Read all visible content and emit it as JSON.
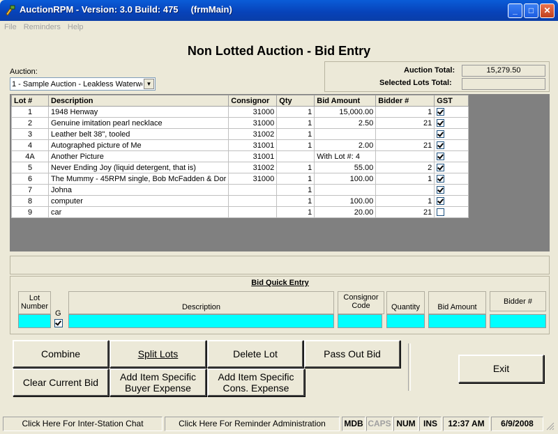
{
  "window": {
    "title": "AuctionRPM - Version: 3.0 Build: 475     (frmMain)"
  },
  "menu": [
    "File",
    "Reminders",
    "Help"
  ],
  "heading": "Non Lotted Auction - Bid Entry",
  "auction": {
    "label": "Auction:",
    "selected": "1 - Sample Auction - Leakless Waterwo"
  },
  "totals": {
    "auction_label": "Auction Total:",
    "auction_value": "15,279.50",
    "selected_label": "Selected Lots Total:",
    "selected_value": ""
  },
  "grid": {
    "headers": [
      "Lot #",
      "Description",
      "Consignor",
      "Qty",
      "Bid Amount",
      "Bidder #",
      "GST"
    ],
    "rows": [
      {
        "lot": "1",
        "desc": "1948 Henway",
        "consignor": "31000",
        "qty": "1",
        "bid": "15,000.00",
        "bidder": "1",
        "gst": true
      },
      {
        "lot": "2",
        "desc": "Genuine imitation pearl necklace",
        "consignor": "31000",
        "qty": "1",
        "bid": "2.50",
        "bidder": "21",
        "gst": true
      },
      {
        "lot": "3",
        "desc": "Leather belt 38\", tooled",
        "consignor": "31002",
        "qty": "1",
        "bid": "",
        "bidder": "",
        "gst": true
      },
      {
        "lot": "4",
        "desc": "Autographed picture of Me",
        "consignor": "31001",
        "qty": "1",
        "bid": "2.00",
        "bidder": "21",
        "gst": true
      },
      {
        "lot": "4A",
        "desc": "Another Picture",
        "consignor": "31001",
        "qty": "",
        "bid": "With Lot #: 4",
        "bidder": "",
        "gst": true
      },
      {
        "lot": "5",
        "desc": "Never Ending Joy (liquid detergent, that is)",
        "consignor": "31002",
        "qty": "1",
        "bid": "55.00",
        "bidder": "2",
        "gst": true
      },
      {
        "lot": "6",
        "desc": "The Mummy - 45RPM single, Bob McFadden & Dor",
        "consignor": "31000",
        "qty": "1",
        "bid": "100.00",
        "bidder": "1",
        "gst": true
      },
      {
        "lot": "7",
        "desc": "Johna",
        "consignor": "",
        "qty": "1",
        "bid": "",
        "bidder": "",
        "gst": true
      },
      {
        "lot": "8",
        "desc": "computer",
        "consignor": "",
        "qty": "1",
        "bid": "100.00",
        "bidder": "1",
        "gst": true
      },
      {
        "lot": "9",
        "desc": "car",
        "consignor": "",
        "qty": "1",
        "bid": "20.00",
        "bidder": "21",
        "gst": false
      }
    ]
  },
  "quick_entry": {
    "title": "Bid Quick Entry",
    "lot_label": "Lot Number",
    "g_label": "G",
    "description_label": "Description",
    "consignor_label": "Consignor Code",
    "quantity_label": "Quantity",
    "bid_label": "Bid Amount",
    "bidder_label": "Bidder #"
  },
  "buttons": {
    "combine": "Combine",
    "split": "Split Lots",
    "delete": "Delete Lot",
    "pass_out": "Pass Out Bid",
    "exit": "Exit",
    "clear": "Clear Current Bid",
    "buyer_exp_1": "Add Item Specific",
    "buyer_exp_2": "Buyer Expense",
    "cons_exp_1": "Add Item Specific",
    "cons_exp_2": "Cons. Expense"
  },
  "status": {
    "chat": "Click Here For Inter-Station Chat",
    "reminder": "Click Here For Reminder Administration",
    "mdb": "MDB",
    "caps": "CAPS",
    "num": "NUM",
    "ins": "INS",
    "time": "12:37 AM",
    "date": "6/9/2008"
  },
  "colors": {
    "titlebar": "#0742b8",
    "entry_fill": "#00ffff",
    "grid_bg": "#808080"
  }
}
